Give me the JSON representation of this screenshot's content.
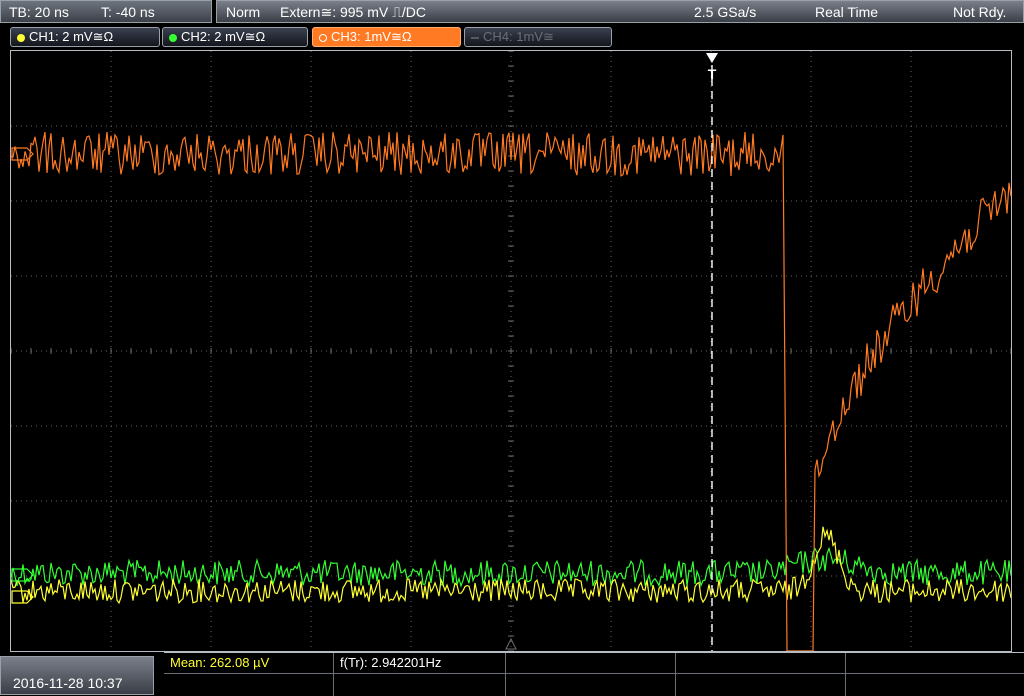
{
  "timebase": {
    "tb": "TB: 20 ns",
    "trig_offset": "T: -40 ns"
  },
  "status": {
    "mode": "Norm",
    "trigger": "Extern≅: 995 mV ⎍/DC",
    "sample_rate": "2.5 GSa/s",
    "acq": "Real Time",
    "state": "Not Rdy."
  },
  "channels": [
    {
      "label": "CH1: 2 mV≅Ω",
      "color": "#ffff33",
      "active": false
    },
    {
      "label": "CH2: 2 mV≅Ω",
      "color": "#33ff33",
      "active": false
    },
    {
      "label": "CH3: 1mV≅Ω",
      "color": "#ff7a22",
      "active": true
    },
    {
      "label": "CH4: 1mV≅",
      "color": "#555a62",
      "active": false
    }
  ],
  "trigger_marker": "T",
  "datetime": "2016-11-28 10:37",
  "measurements": {
    "mean": "Mean: 262.08 µV",
    "freq": "f(Tr): 2.942201Hz"
  },
  "colors": {
    "ch1": "#ffff33",
    "ch2": "#33ff33",
    "ch3": "#ff7a22",
    "grid": "#6a6e76"
  }
}
